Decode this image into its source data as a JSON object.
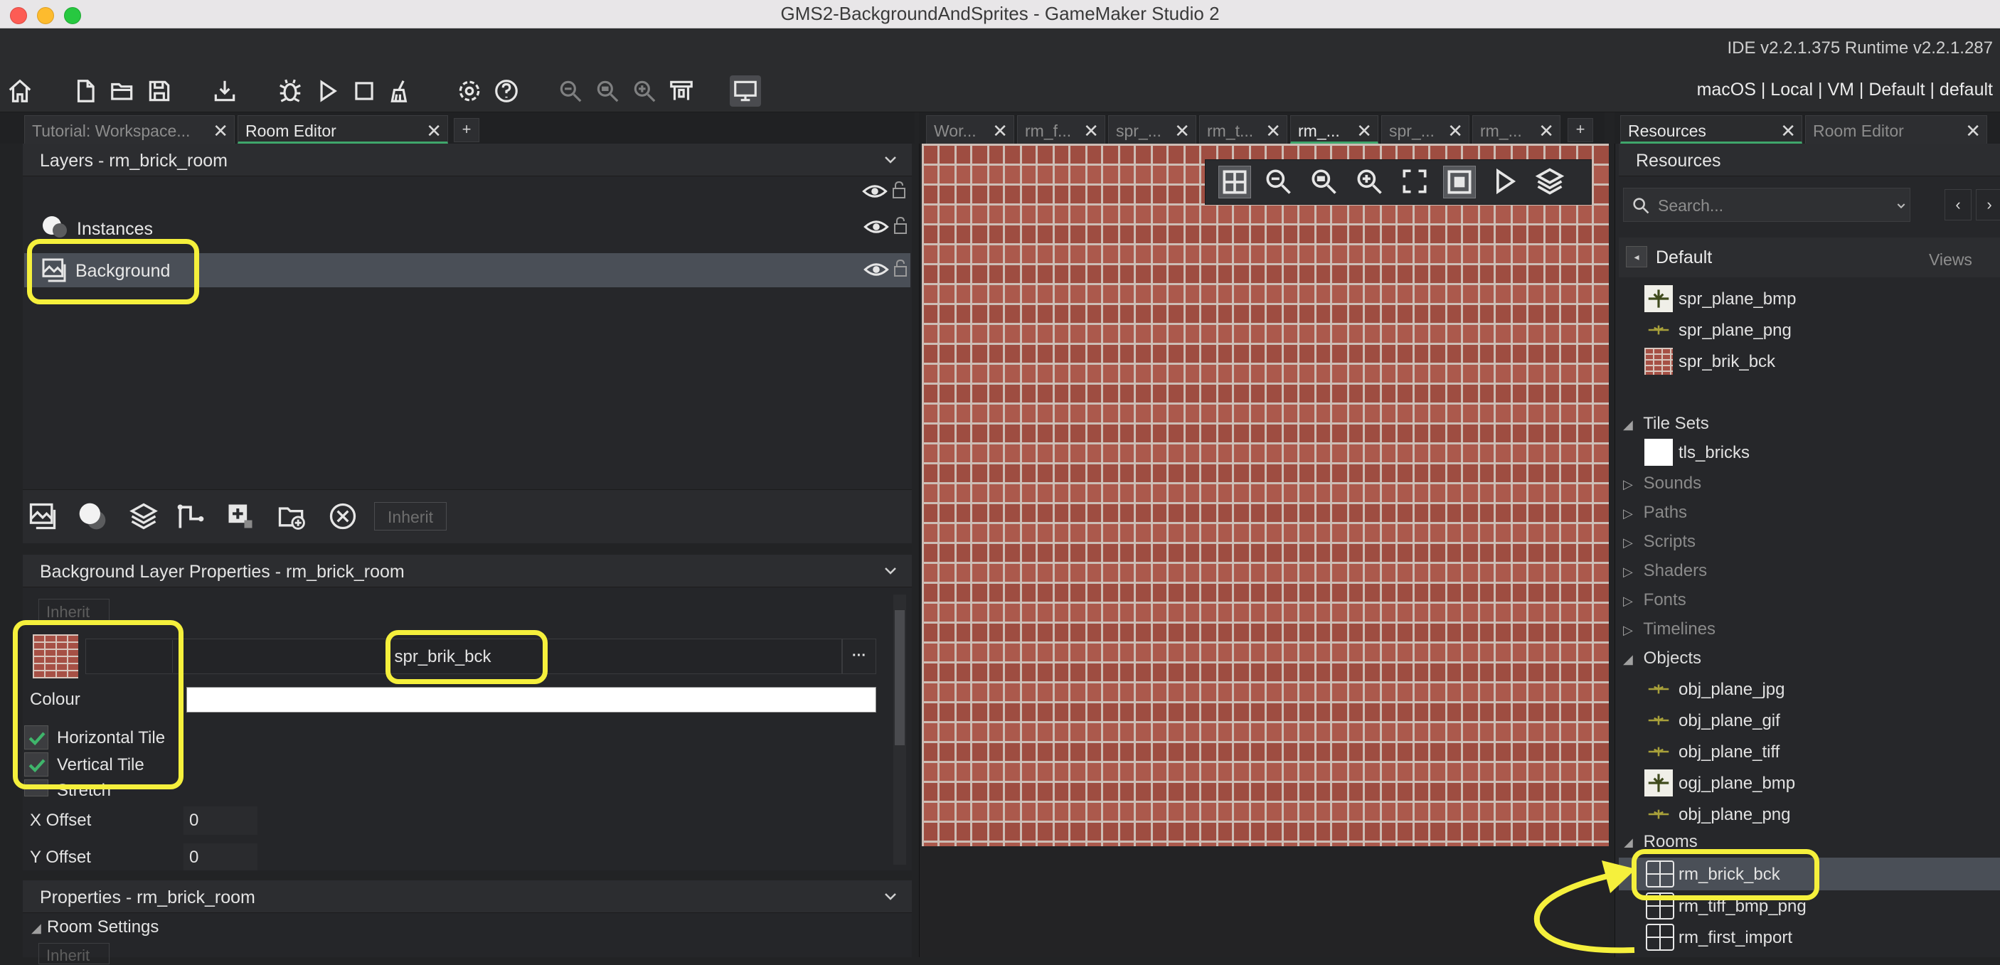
{
  "window": {
    "title": "GMS2-BackgroundAndSprites - GameMaker Studio 2",
    "version": "IDE v2.2.1.375  Runtime v2.2.1.287",
    "target": "macOS | Local | VM | Default | default"
  },
  "colors": {
    "highlight": "#f5f03c",
    "accent_tab": "#3fa66b",
    "brick": "#a65045"
  },
  "left_tabs": [
    {
      "label": "Tutorial: Workspace...",
      "active": false
    },
    {
      "label": "Room Editor",
      "active": true
    }
  ],
  "layers_panel": {
    "title": "Layers - rm_brick_room",
    "layers": [
      {
        "name": "Instances",
        "icon": "instance-layer-icon"
      },
      {
        "name": "Background",
        "icon": "background-layer-icon",
        "selected": true
      }
    ],
    "inherit_label": "Inherit"
  },
  "bg_props": {
    "title": "Background Layer Properties - rm_brick_room",
    "inherit_label": "Inherit",
    "sprite_name": "spr_brik_bck",
    "more_label": "···",
    "colour_label": "Colour",
    "horizontal_tile": "Horizontal Tile",
    "vertical_tile": "Vertical Tile",
    "stretch": "Stretch",
    "x_offset_label": "X Offset",
    "x_offset": "0",
    "y_offset_label": "Y Offset",
    "y_offset": "0"
  },
  "room_props": {
    "title": "Properties - rm_brick_room",
    "room_settings": "Room Settings",
    "inherit_label": "Inherit"
  },
  "room_tabs": [
    {
      "label": "Wor..."
    },
    {
      "label": "rm_f..."
    },
    {
      "label": "spr_..."
    },
    {
      "label": "rm_t..."
    },
    {
      "label": "rm_...",
      "active": true
    },
    {
      "label": "spr_..."
    },
    {
      "label": "rm_..."
    }
  ],
  "right_tabs": [
    {
      "label": "Resources",
      "active": true
    },
    {
      "label": "Room Editor",
      "active": false
    }
  ],
  "resources": {
    "title": "Resources",
    "search_placeholder": "Search...",
    "group": "Default",
    "views_label": "Views",
    "sprites": [
      "spr_plane_bmp",
      "spr_plane_png",
      "spr_brik_bck"
    ],
    "tile_sets_label": "Tile Sets",
    "tile_sets": [
      "tls_bricks"
    ],
    "closed_folders": [
      "Sounds",
      "Paths",
      "Scripts",
      "Shaders",
      "Fonts",
      "Timelines"
    ],
    "objects_label": "Objects",
    "objects": [
      "obj_plane_jpg",
      "obj_plane_gif",
      "obj_plane_tiff",
      "ogj_plane_bmp",
      "obj_plane_png"
    ],
    "rooms_label": "Rooms",
    "rooms": [
      "rm_brick_bck",
      "rm_tiff_bmp_png",
      "rm_first_import"
    ]
  }
}
